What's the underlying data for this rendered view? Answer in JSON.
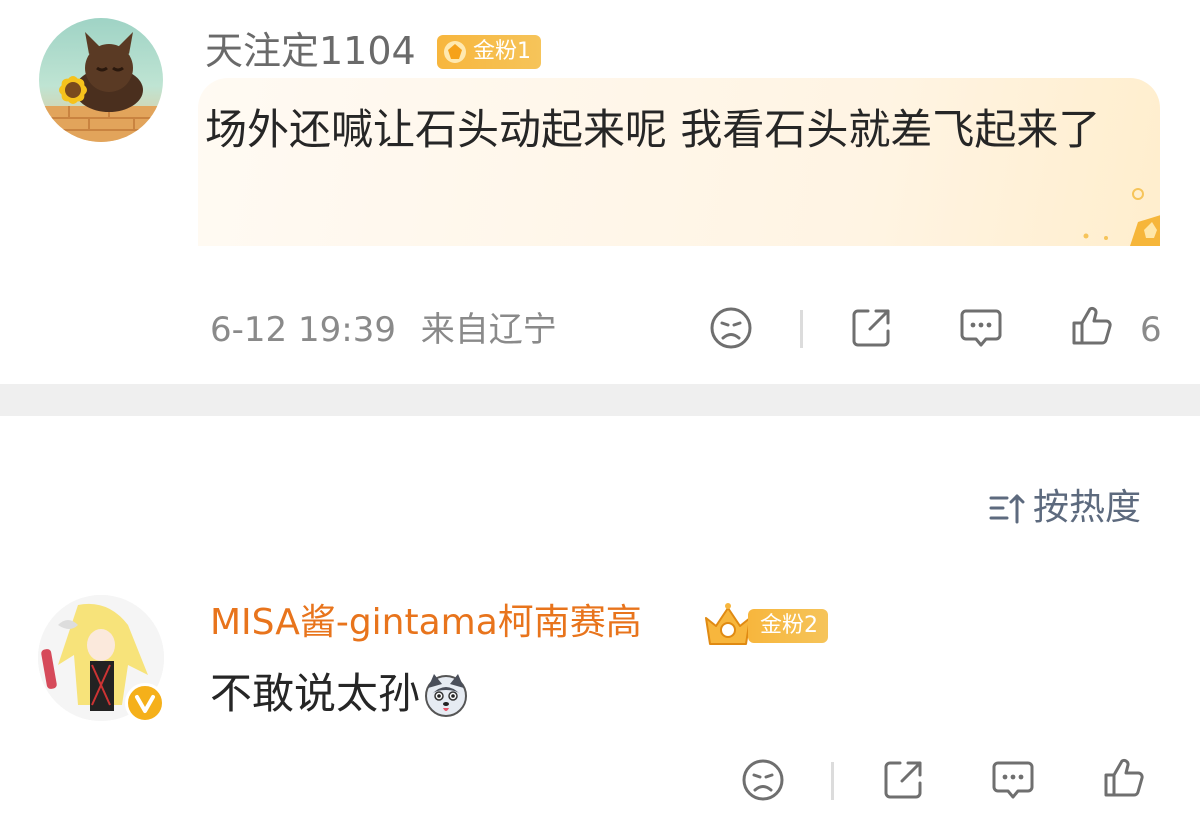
{
  "comments": [
    {
      "username": "天注定1104",
      "badge": "金粉1",
      "text": "场外还喊让石头动起来呢 我看石头就差飞起来了",
      "timestamp": "6-12 19:39",
      "location": "来自辽宁",
      "likes": "6"
    },
    {
      "username": "MISA酱-gintama柯南赛高",
      "badge": "金粉2",
      "text": "不敢说太孙",
      "emoji": "husky-dog-emoji",
      "verified": true
    }
  ],
  "sort": {
    "label": "按热度",
    "icon": "sort-icon"
  },
  "colors": {
    "username_gray": "#6a6a6a",
    "username_orange": "#e8741c",
    "badge_gold": "#f7b63d",
    "meta_gray": "#8a8a8a",
    "sort_blue_gray": "#5d6a7e",
    "separator": "#efefef"
  }
}
